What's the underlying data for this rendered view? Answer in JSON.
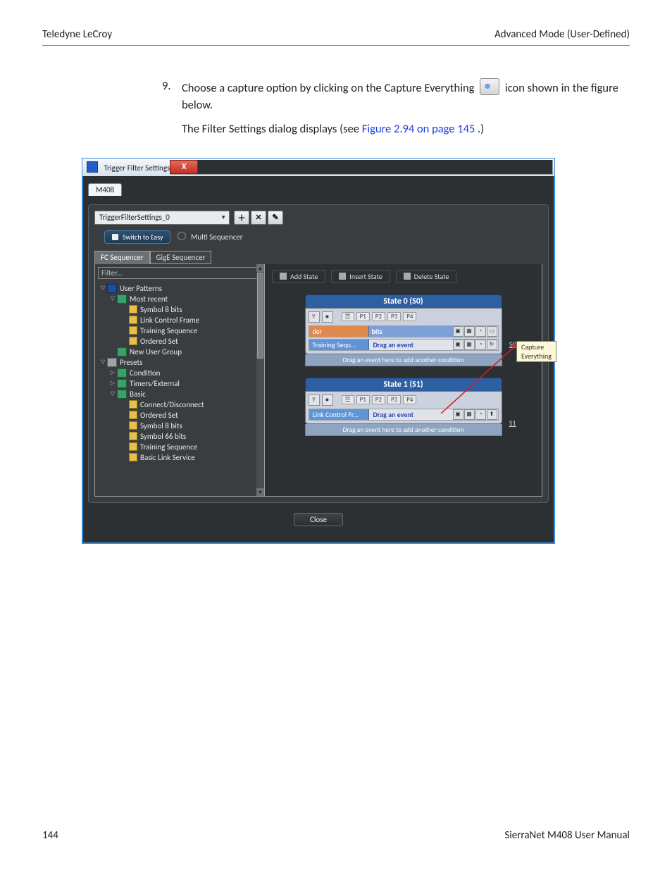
{
  "header": {
    "left": "Teledyne LeCroy",
    "right": "Advanced Mode (User-Defined)"
  },
  "step": {
    "num": "9.",
    "line1a": "Choose a capture option by clicking on the Capture Everything ",
    "line1b": " icon shown in the figure below.",
    "line2a": "The Filter Settings dialog displays (see ",
    "link": "Figure 2.94 on page 145",
    "line2b": ".)"
  },
  "dialog": {
    "title": "Trigger Filter Settings",
    "tab": "M408",
    "settings_name": "TriggerFilterSettings_0",
    "switch_btn": "Switch to Easy",
    "multi_label": "Multi Sequencer",
    "subtabs": {
      "fc": "FC Sequencer",
      "gige": "GigE Sequencer"
    },
    "filter_placeholder": "Filter...",
    "tree": {
      "user_patterns": "User Patterns",
      "most_recent": "Most recent",
      "sym8": "Symbol 8 bits",
      "lcf": "Link Control Frame",
      "train": "Training Sequence",
      "ord": "Ordered Set",
      "new_group": "New User Group",
      "presets": "Presets",
      "condition": "Condition",
      "timers": "Timers/External",
      "basic": "Basic",
      "conn": "Connect/Disconnect",
      "ord2": "Ordered Set",
      "sym8b": "Symbol 8 bits",
      "sym66": "Symbol 66 bits",
      "train2": "Training Sequence",
      "bls": "Basic Link Service"
    },
    "state_btns": {
      "add": "Add State",
      "insert": "Insert State",
      "delete": "Delete State"
    },
    "states": [
      {
        "title": "State 0 (S0)",
        "ports": [
          "P1",
          "P2",
          "P3",
          "P4"
        ],
        "events": [
          {
            "label": "der",
            "label_cls": "orange",
            "bits": "bits",
            "drag": ""
          },
          {
            "label": "Training Sequ...",
            "label_cls": "",
            "drag": "Drag an event"
          }
        ],
        "bar": "Drag an event here to add another condition",
        "side": "S0"
      },
      {
        "title": "State 1 (S1)",
        "ports": [
          "P1",
          "P2",
          "P3",
          "P4"
        ],
        "events": [
          {
            "label": "Link Control Fr...",
            "label_cls": "",
            "drag": "Drag an event"
          }
        ],
        "bar": "Drag an event here to add another condition",
        "side": "S1"
      }
    ],
    "tooltip": "Capture Everything",
    "close": "Close"
  },
  "footer": {
    "page": "144",
    "doc": "SierraNet M408 User Manual"
  }
}
